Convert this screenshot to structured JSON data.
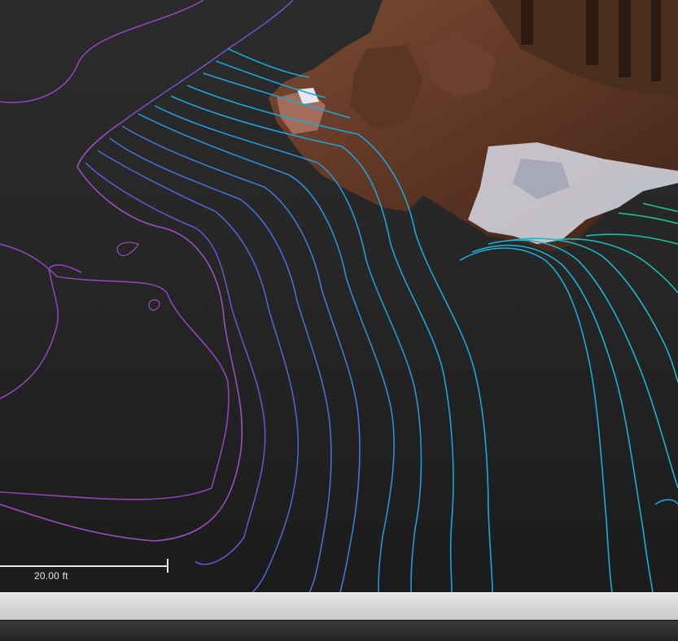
{
  "viewport": {
    "scale_bar": {
      "label": "20.00 ft"
    }
  },
  "colors": {
    "background": "#262626",
    "contour_low": "#8a47b8",
    "contour_mid": "#3b5fd0",
    "contour_high": "#1aa8d8",
    "contour_green": "#1fc08a",
    "scale_bar": "#e8e8e8",
    "status_bar": "#d6d6d6"
  }
}
